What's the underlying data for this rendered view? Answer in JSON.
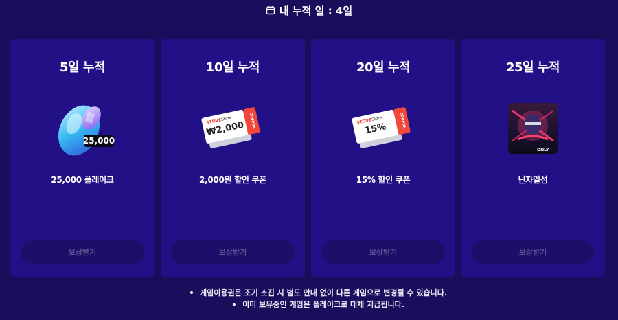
{
  "header": {
    "icon": "calendar-icon",
    "title": "내 누적 일 : 4일"
  },
  "cards": [
    {
      "title": "5일 누적",
      "reward_icon": "crystal-icon",
      "reward_badge": "25,000",
      "reward_name": "25,000 플레이크",
      "button_label": "보상받기"
    },
    {
      "title": "10일 누적",
      "reward_icon": "coupon-icon",
      "coupon_brand": "STOVE",
      "coupon_store": "Store",
      "coupon_value": "₩2,000",
      "coupon_stub": "COUPON",
      "reward_name": "2,000원 할인 쿠폰",
      "button_label": "보상받기"
    },
    {
      "title": "20일 누적",
      "reward_icon": "coupon-icon",
      "coupon_brand": "STOVE",
      "coupon_store": "Store",
      "coupon_value": "15%",
      "coupon_stub": "COUPON",
      "reward_name": "15% 할인 쿠폰",
      "button_label": "보상받기"
    },
    {
      "title": "25일 누적",
      "reward_icon": "game-cover-icon",
      "game_tag": "ONLY",
      "reward_name": "닌자일섬",
      "button_label": "보상받기"
    }
  ],
  "notes": [
    "게임이용권은 조기 소진 시 별도 안내 없이 다른 게임으로 변경될 수 있습니다.",
    "이미 보유중인 게임은 플레이크로 대체 지급됩니다."
  ],
  "colors": {
    "background": "#1a0e5c",
    "card": "#221186",
    "button": "#1b0f6a",
    "button_text": "#5a5290",
    "coupon_accent": "#f2473b"
  }
}
